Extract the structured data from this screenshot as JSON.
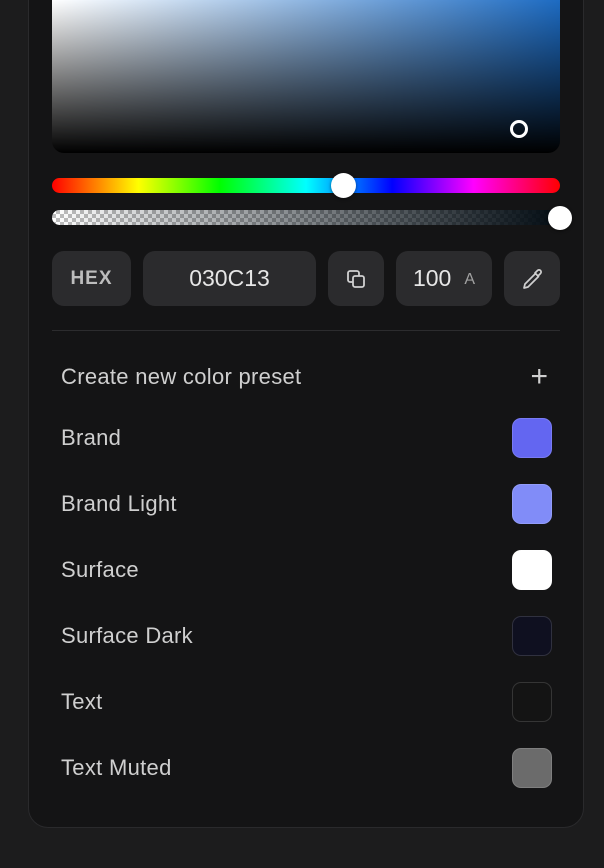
{
  "picker": {
    "mode_label": "HEX",
    "hex_value": "030C13",
    "alpha_value": "100",
    "alpha_unit": "A",
    "hue_color": "#1d6bc2"
  },
  "presets": {
    "create_label": "Create new color preset",
    "items": [
      {
        "label": "Brand",
        "color": "#6366f1"
      },
      {
        "label": "Brand Light",
        "color": "#818cf8"
      },
      {
        "label": "Surface",
        "color": "#ffffff"
      },
      {
        "label": "Surface Dark",
        "color": "#0f1020"
      },
      {
        "label": "Text",
        "color": "#141414"
      },
      {
        "label": "Text Muted",
        "color": "#6b6b6b"
      }
    ]
  }
}
